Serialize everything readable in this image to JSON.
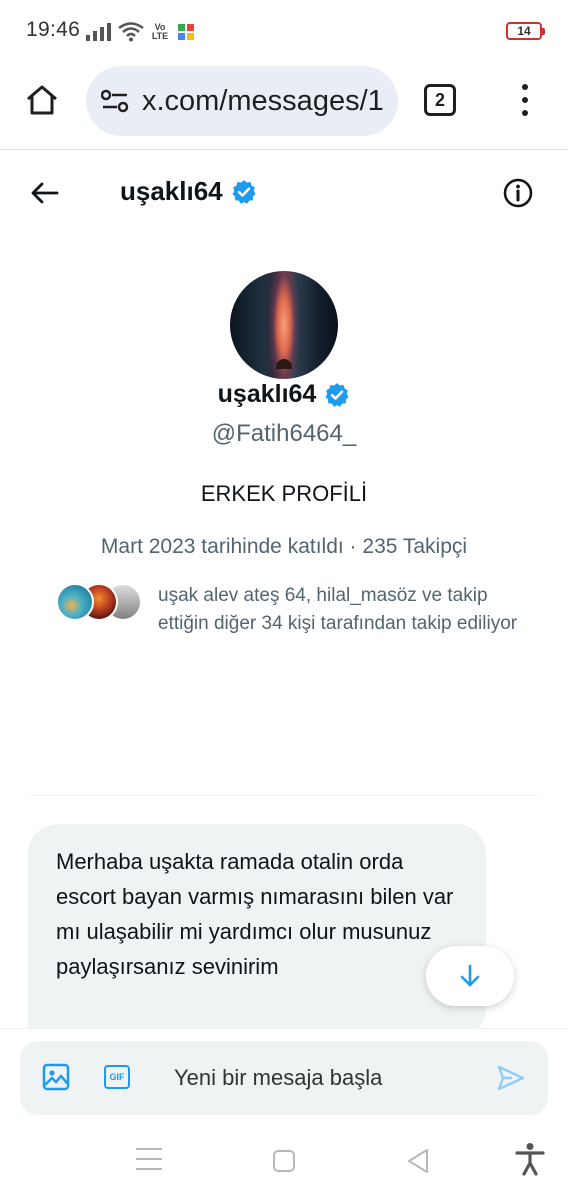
{
  "status_bar": {
    "time": "19:46",
    "volte_label": "Vo LTE",
    "battery_level": "14",
    "battery_color": "#d32f2f"
  },
  "browser": {
    "url": "x.com/messages/1",
    "tab_count": "2"
  },
  "conversation": {
    "title": "uşaklı64",
    "verified": true
  },
  "profile": {
    "name": "uşaklı64",
    "handle": "@Fatih6464_",
    "bio": "ERKEK PROFİLİ",
    "meta": "Mart 2023 tarihinde katıldı · 235 Takipçi",
    "followed_by_text": "uşak alev ateş 64, hilal_masöz ve takip ettiğin diğer 34 kişi tarafından takip ediliyor"
  },
  "messages": [
    {
      "text": "Merhaba uşakta ramada otalin orda escort bayan varmış nımarasını bilen var mı ulaşabilir mi yardımcı olur musunuz paylaşırsanız sevinirim"
    }
  ],
  "composer": {
    "placeholder": "Yeni bir mesaja başla",
    "gif_label": "GIF"
  },
  "colors": {
    "accent": "#1d9bf0",
    "secondary_text": "#536471",
    "bubble_bg": "#eff3f4"
  },
  "icons": [
    "home-icon",
    "site-settings-icon",
    "tabs-icon",
    "more-vertical-icon",
    "arrow-left-icon",
    "verified-badge-icon",
    "info-icon",
    "arrow-down-icon",
    "image-icon",
    "gif-icon",
    "send-icon",
    "recents-icon",
    "nav-home-icon",
    "nav-back-icon",
    "accessibility-icon"
  ]
}
